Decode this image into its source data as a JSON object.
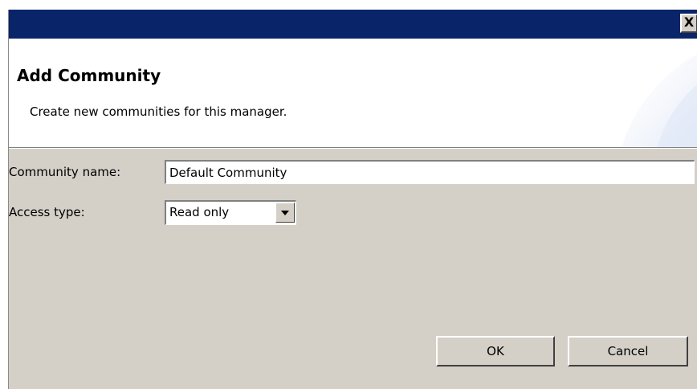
{
  "window": {
    "close_glyph": "X"
  },
  "header": {
    "title": "Add Community",
    "subtitle": "Create new communities for this manager."
  },
  "form": {
    "community_name_label": "Community name:",
    "community_name_value": "Default Community",
    "access_type_label": "Access type:",
    "access_type_value": "Read only"
  },
  "buttons": {
    "ok_label": "OK",
    "cancel_label": "Cancel"
  },
  "colors": {
    "titlebar": "#0a246a",
    "dialog_background": "#d4d0c8",
    "header_background": "#ffffff"
  }
}
